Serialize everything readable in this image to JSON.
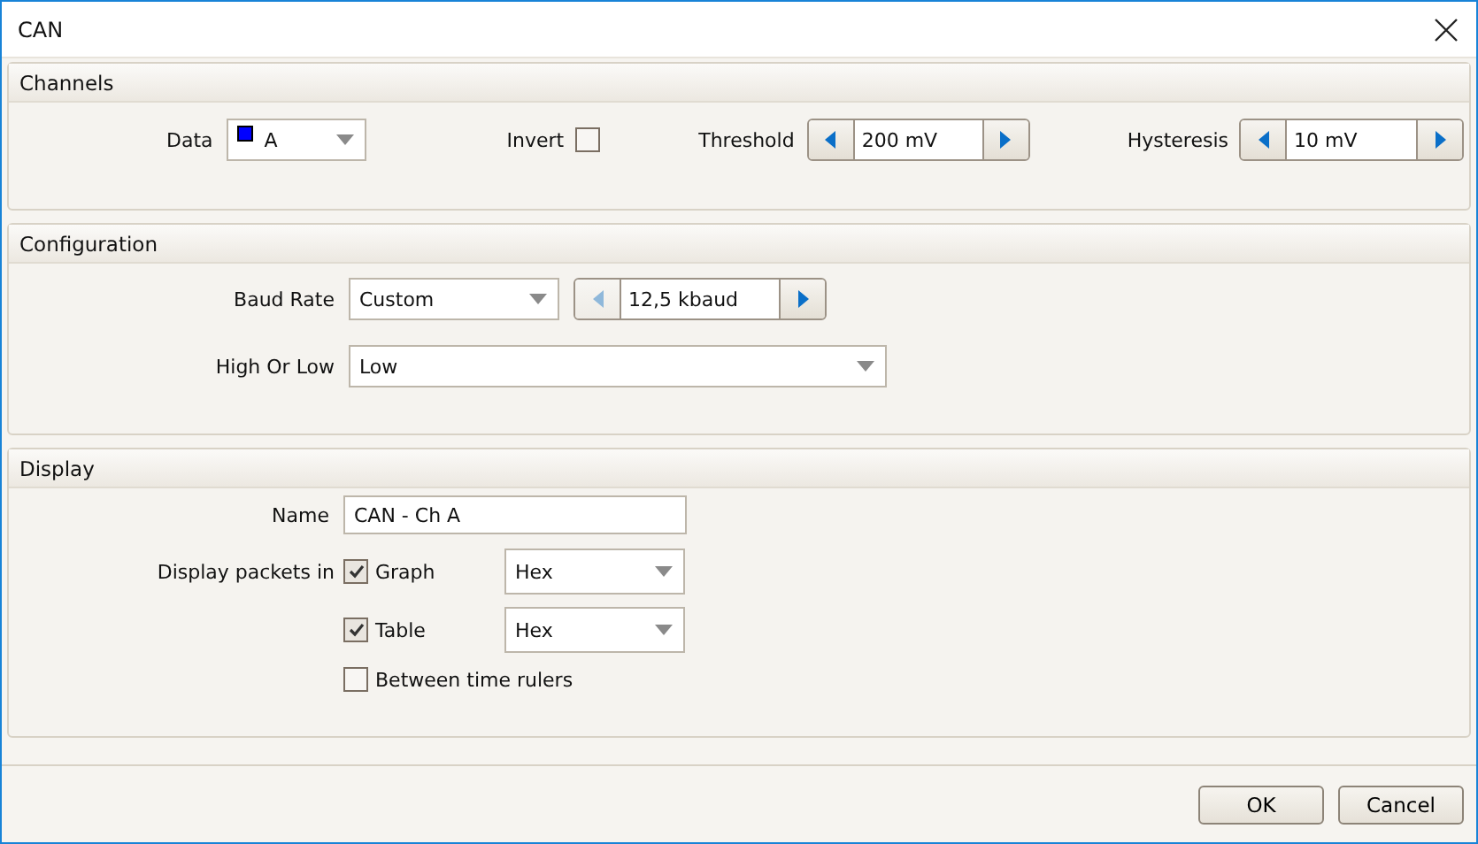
{
  "window": {
    "title": "CAN"
  },
  "channels": {
    "title": "Channels",
    "data": {
      "label": "Data",
      "value": "A",
      "color": "#0000ff"
    },
    "invert": {
      "label": "Invert",
      "checked": false
    },
    "threshold": {
      "label": "Threshold",
      "value": "200 mV",
      "decrease_enabled": true
    },
    "hysteresis": {
      "label": "Hysteresis",
      "value": "10 mV",
      "decrease_enabled": true
    }
  },
  "configuration": {
    "title": "Configuration",
    "baud_rate": {
      "label": "Baud Rate",
      "value": "Custom",
      "custom_value": "12,5 kbaud",
      "decrease_enabled": false
    },
    "high_or_low": {
      "label": "High Or Low",
      "value": "Low"
    }
  },
  "display": {
    "title": "Display",
    "name": {
      "label": "Name",
      "value": "CAN - Ch A"
    },
    "packets_label": "Display packets in",
    "options": [
      {
        "label": "Graph",
        "checked": true,
        "format": "Hex"
      },
      {
        "label": "Table",
        "checked": true,
        "format": "Hex"
      },
      {
        "label": "Between time rulers",
        "checked": false
      }
    ]
  },
  "buttons": [
    "OK",
    "Cancel"
  ]
}
